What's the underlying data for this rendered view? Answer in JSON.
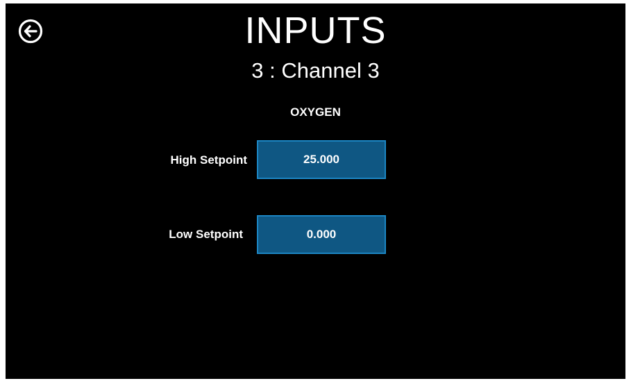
{
  "header": {
    "title": "INPUTS",
    "subtitle": "3 : Channel 3",
    "back_icon": "arrow-left-circle-icon"
  },
  "channel": {
    "gas": "OXYGEN",
    "setpoints": {
      "high_label": "High Setpoint",
      "high_value": "25.000",
      "low_label": "Low Setpoint",
      "low_value": "0.000"
    }
  },
  "colors": {
    "background": "#000000",
    "field_fill": "#0f5783",
    "field_border": "#1c86c4",
    "text": "#ffffff"
  }
}
